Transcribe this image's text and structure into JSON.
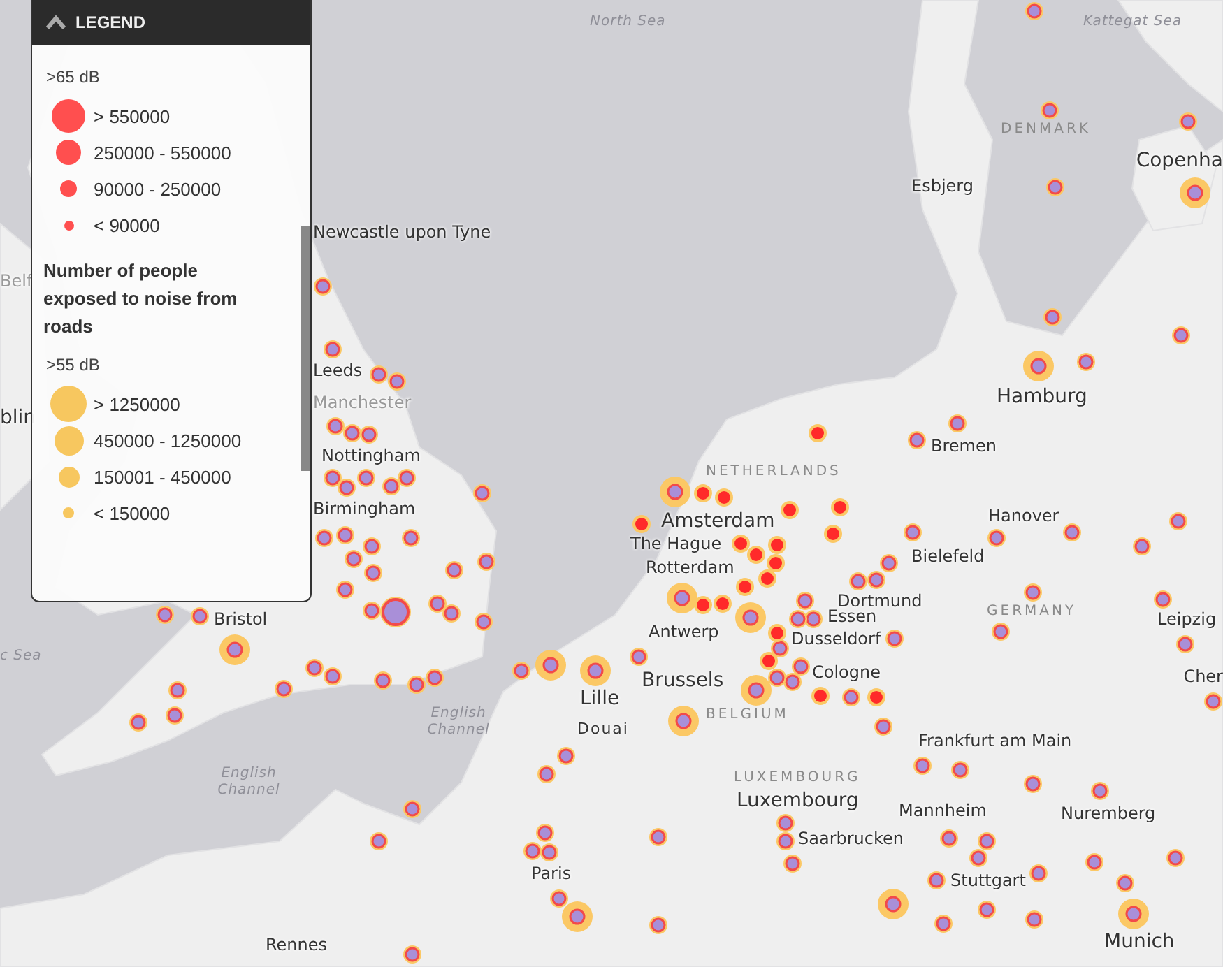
{
  "legend": {
    "title": "LEGEND",
    "expanded": true,
    "groups": [
      {
        "kind": "swatches",
        "heading": ">65 dB",
        "color": "#ff4f4f",
        "items": [
          {
            "label": "> 550000"
          },
          {
            "label": "250000 - 550000"
          },
          {
            "label": "90000 - 250000"
          },
          {
            "label": "< 90000"
          }
        ]
      },
      {
        "kind": "title",
        "text": "Number of people exposed to noise from roads"
      },
      {
        "kind": "swatches",
        "heading": ">55 dB",
        "color": "#f7c75f",
        "items": [
          {
            "label": "> 1250000"
          },
          {
            "label": "450000 - 1250000"
          },
          {
            "label": "150001 - 450000"
          },
          {
            "label": "< 150000"
          }
        ]
      }
    ]
  },
  "map": {
    "labels": [
      {
        "kind": "sea",
        "text": "North Sea"
      },
      {
        "kind": "sea",
        "text": "Kattegat Sea"
      },
      {
        "kind": "country",
        "text": "DENMARK"
      },
      {
        "kind": "city-large",
        "text": "Copenha"
      },
      {
        "kind": "city",
        "text": "Esbjerg"
      },
      {
        "kind": "city",
        "text": "Newcastle upon Tyne"
      },
      {
        "kind": "city-faint",
        "text": "Belf"
      },
      {
        "kind": "city",
        "text": "Leeds"
      },
      {
        "kind": "city-large",
        "text": "Hamburg"
      },
      {
        "kind": "city-faint",
        "text": "Manchester"
      },
      {
        "kind": "city-large",
        "text": "blin"
      },
      {
        "kind": "city",
        "text": "Bremen"
      },
      {
        "kind": "city",
        "text": "Nottingham"
      },
      {
        "kind": "country",
        "text": "NETHERLANDS"
      },
      {
        "kind": "city",
        "text": "Birmingham"
      },
      {
        "kind": "city-large",
        "text": "Amsterdam"
      },
      {
        "kind": "city",
        "text": "Hanover"
      },
      {
        "kind": "city",
        "text": "The Hague"
      },
      {
        "kind": "city",
        "text": "Bielefeld"
      },
      {
        "kind": "city",
        "text": "Rotterdam"
      },
      {
        "kind": "city",
        "text": "Dortmund"
      },
      {
        "kind": "city",
        "text": "Bristol"
      },
      {
        "kind": "country",
        "text": "GERMANY"
      },
      {
        "kind": "city",
        "text": "Essen"
      },
      {
        "kind": "city",
        "text": "Leipzig"
      },
      {
        "kind": "city",
        "text": "Antwerp"
      },
      {
        "kind": "city",
        "text": "Dusseldorf"
      },
      {
        "kind": "sea",
        "text": "c Sea"
      },
      {
        "kind": "city-large",
        "text": "Brussels"
      },
      {
        "kind": "city",
        "text": "Cologne"
      },
      {
        "kind": "city",
        "text": "Cher"
      },
      {
        "kind": "city-large",
        "text": "Lille"
      },
      {
        "kind": "country",
        "text": "BELGIUM"
      },
      {
        "kind": "sea",
        "text": "English Channel"
      },
      {
        "kind": "city-small",
        "text": "Douai"
      },
      {
        "kind": "city",
        "text": "Frankfurt am Main"
      },
      {
        "kind": "sea",
        "text": "English Channel"
      },
      {
        "kind": "country",
        "text": "LUXEMBOURG"
      },
      {
        "kind": "city-large",
        "text": "Luxembourg"
      },
      {
        "kind": "city",
        "text": "Mannheim"
      },
      {
        "kind": "city",
        "text": "Nuremberg"
      },
      {
        "kind": "city",
        "text": "Saarbrucken"
      },
      {
        "kind": "city",
        "text": "Paris"
      },
      {
        "kind": "city",
        "text": "Stuttgart"
      },
      {
        "kind": "city",
        "text": "Rennes"
      },
      {
        "kind": "city-large",
        "text": "Munich"
      }
    ]
  }
}
